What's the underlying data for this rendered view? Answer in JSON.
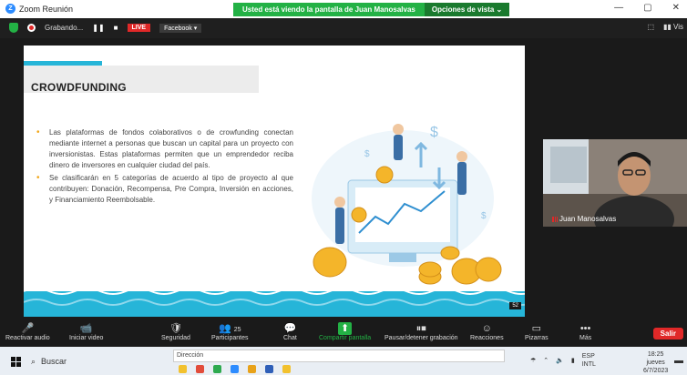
{
  "window": {
    "title": "Zoom Reunión",
    "share_message": "Usted está viendo la pantalla de Juan Manosalvas",
    "view_options": "Opciones de vista ⌄",
    "controls": [
      "—",
      "▢",
      "✕"
    ]
  },
  "meeting_bar": {
    "recording": "Grabando...",
    "pause_symbol": "❚❚",
    "stop_symbol": "■",
    "live": "LIVE",
    "stream_target": "Facebook ▾",
    "view_label": "Vis"
  },
  "slide": {
    "title": "CROWDFUNDING",
    "bullets": [
      "Las plataformas de fondos colaborativos o de crowfunding conectan mediante internet a personas que buscan un capital para un proyecto con inversionistas. Estas plataformas permiten que un emprendedor reciba dinero de inversores en cualquier ciudad del país.",
      "Se clasificarán en 5 categorías de acuerdo al tipo de proyecto al que contribuyen: Donación, Recompensa, Pre Compra, Inversión en acciones, y Financiamiento Reembolsable."
    ],
    "page_number": "52"
  },
  "video": {
    "participant_name": "Juan Manosalvas"
  },
  "toolbar": {
    "items": [
      {
        "label": "Reactivar audio",
        "icon": "mic-muted-icon",
        "glyph": "🎤"
      },
      {
        "label": "Iniciar video",
        "icon": "video-off-icon",
        "glyph": "📹"
      },
      {
        "label": "Seguridad",
        "icon": "shield-icon",
        "glyph": "🛡"
      },
      {
        "label": "Participantes",
        "icon": "participants-icon",
        "glyph": "👥",
        "count": "25"
      },
      {
        "label": "Chat",
        "icon": "chat-icon",
        "glyph": "💬"
      },
      {
        "label": "Compartir pantalla",
        "icon": "share-screen-icon",
        "glyph": "⬆"
      },
      {
        "label": "Pausar/detener grabación",
        "icon": "pause-record-icon",
        "glyph": "⏸⏹"
      },
      {
        "label": "Reacciones",
        "icon": "reactions-icon",
        "glyph": "☺"
      },
      {
        "label": "Pizarras",
        "icon": "whiteboard-icon",
        "glyph": "▭"
      },
      {
        "label": "Más",
        "icon": "more-icon",
        "glyph": "•••"
      }
    ],
    "leave": "Salir"
  },
  "taskbar": {
    "search_placeholder": "Buscar",
    "address_label": "Dirección",
    "language": "ESP",
    "layout": "INTL",
    "time": "18:25",
    "day": "jueves",
    "date": "6/7/2023"
  }
}
